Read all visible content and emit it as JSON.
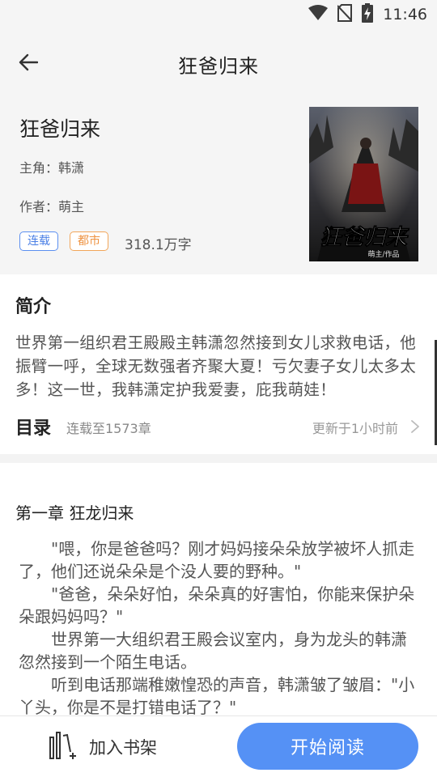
{
  "status_bar": {
    "time": "11:46",
    "icons": [
      "wifi-icon",
      "no-sim-icon",
      "battery-charging-icon"
    ]
  },
  "nav": {
    "back_icon": "arrow-left-icon",
    "title": "狂爸归来"
  },
  "book": {
    "title": "狂爸归来",
    "protagonist": "主角：韩潇",
    "author": "作者：萌主",
    "tags": [
      "连载",
      "都市"
    ],
    "word_count": "318.1万字",
    "cover": {
      "title_text": "狂爸归来",
      "credit_text": "萌主/作品"
    }
  },
  "intro": {
    "heading": "简介",
    "text": "世界第一组织君王殿殿主韩潇忽然接到女儿求救电话，他振臂一呼，全球无数强者齐聚大夏！亏欠妻子女儿太多太多！这一世，我韩潇定护我爱妻，庇我萌娃！"
  },
  "toc": {
    "label": "目录",
    "status": "连载至1573章",
    "update": "更新于1小时前",
    "chevron_icon": "chevron-right-icon"
  },
  "chapter": {
    "title": "第一章 狂龙归来",
    "paragraphs": [
      "\"喂，你是爸爸吗？刚才妈妈接朵朵放学被坏人抓走了，他们还说朵朵是个没人要的野种。\"",
      "\"爸爸，朵朵好怕，朵朵真的好害怕，你能来保护朵朵跟妈妈吗？\"",
      "世界第一大组织君王殿会议室内，身为龙头的韩潇忽然接到一个陌生电话。",
      "听到电话那端稚嫩惶恐的声音，韩潇皱了皱眉：\"小丫头，你是不是打错电话了？\""
    ]
  },
  "bottom_bar": {
    "add_shelf_icon": "bookshelf-add-icon",
    "add_shelf_label": "加入书架",
    "start_reading_label": "开始阅读"
  },
  "colors": {
    "accent_blue": "#5591f5",
    "tag_blue": "#4a7fe6",
    "tag_orange": "#ee9240",
    "header_bg": "#f5f5f5"
  }
}
